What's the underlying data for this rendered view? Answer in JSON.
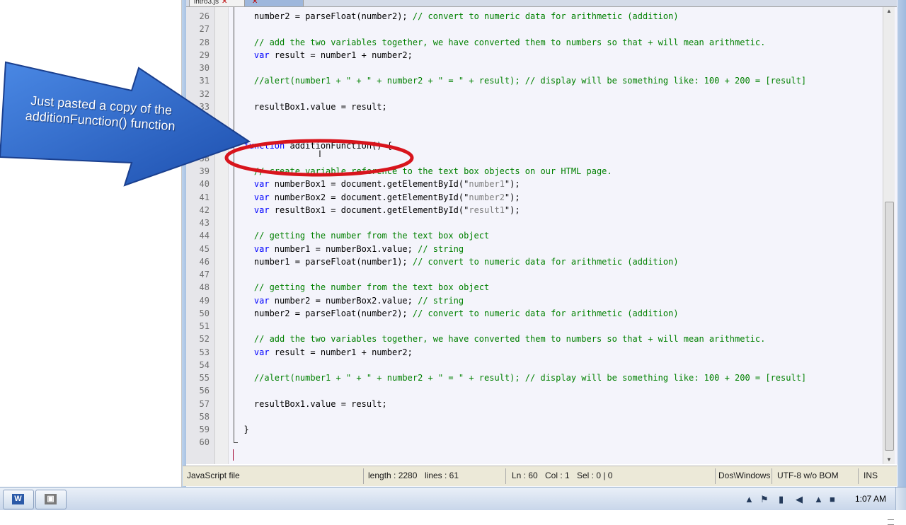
{
  "editor": {
    "tabs": [
      {
        "label": "intro3.js",
        "active": false
      },
      {
        "label": "",
        "active": true
      }
    ],
    "lines": [
      {
        "n": "26",
        "segments": [
          {
            "t": "    number2 = parseFloat(number2); ",
            "c": ""
          },
          {
            "t": "// convert to numeric data for arithmetic (addition)",
            "c": "cmt"
          }
        ]
      },
      {
        "n": "27",
        "segments": []
      },
      {
        "n": "28",
        "segments": [
          {
            "t": "    // add the two variables together, we have converted them to numbers so that + will mean arithmetic.",
            "c": "cmt"
          }
        ]
      },
      {
        "n": "29",
        "segments": [
          {
            "t": "    var",
            "c": "kw"
          },
          {
            "t": " result = number1 + number2;",
            "c": ""
          }
        ]
      },
      {
        "n": "30",
        "segments": []
      },
      {
        "n": "31",
        "segments": [
          {
            "t": "    //alert(number1 + \" + \" + number2 + \" = \" + result); // display will be something like: 100 + 200 = [result]",
            "c": "cmt"
          }
        ]
      },
      {
        "n": "32",
        "segments": []
      },
      {
        "n": "33",
        "segments": [
          {
            "t": "    resultBox1.value = result;",
            "c": ""
          }
        ]
      },
      {
        "n": "",
        "segments": []
      },
      {
        "n": "",
        "segments": []
      },
      {
        "n": "37",
        "segments": [
          {
            "t": "  function",
            "c": "kw"
          },
          {
            "t": " additionFunction() {",
            "c": ""
          }
        ]
      },
      {
        "n": "38",
        "segments": []
      },
      {
        "n": "39",
        "segments": [
          {
            "t": "    // create variable reference to the text box objects on our HTML page.",
            "c": "cmt"
          }
        ]
      },
      {
        "n": "40",
        "segments": [
          {
            "t": "    var",
            "c": "kw"
          },
          {
            "t": " numberBox1 = document.getElementById(\"",
            "c": ""
          },
          {
            "t": "number1",
            "c": "str"
          },
          {
            "t": "\");",
            "c": ""
          }
        ]
      },
      {
        "n": "41",
        "segments": [
          {
            "t": "    var",
            "c": "kw"
          },
          {
            "t": " numberBox2 = document.getElementById(\"",
            "c": ""
          },
          {
            "t": "number2",
            "c": "str"
          },
          {
            "t": "\");",
            "c": ""
          }
        ]
      },
      {
        "n": "42",
        "segments": [
          {
            "t": "    var",
            "c": "kw"
          },
          {
            "t": " resultBox1 = document.getElementById(\"",
            "c": ""
          },
          {
            "t": "result1",
            "c": "str"
          },
          {
            "t": "\");",
            "c": ""
          }
        ]
      },
      {
        "n": "43",
        "segments": []
      },
      {
        "n": "44",
        "segments": [
          {
            "t": "    // getting the number from the text box object",
            "c": "cmt"
          }
        ]
      },
      {
        "n": "45",
        "segments": [
          {
            "t": "    var",
            "c": "kw"
          },
          {
            "t": " number1 = numberBox1.value; ",
            "c": ""
          },
          {
            "t": "// string",
            "c": "cmt"
          }
        ]
      },
      {
        "n": "46",
        "segments": [
          {
            "t": "    number1 = parseFloat(number1); ",
            "c": ""
          },
          {
            "t": "// convert to numeric data for arithmetic (addition)",
            "c": "cmt"
          }
        ]
      },
      {
        "n": "47",
        "segments": []
      },
      {
        "n": "48",
        "segments": [
          {
            "t": "    // getting the number from the text box object",
            "c": "cmt"
          }
        ]
      },
      {
        "n": "49",
        "segments": [
          {
            "t": "    var",
            "c": "kw"
          },
          {
            "t": " number2 = numberBox2.value; ",
            "c": ""
          },
          {
            "t": "// string",
            "c": "cmt"
          }
        ]
      },
      {
        "n": "50",
        "segments": [
          {
            "t": "    number2 = parseFloat(number2); ",
            "c": ""
          },
          {
            "t": "// convert to numeric data for arithmetic (addition)",
            "c": "cmt"
          }
        ]
      },
      {
        "n": "51",
        "segments": []
      },
      {
        "n": "52",
        "segments": [
          {
            "t": "    // add the two variables together, we have converted them to numbers so that + will mean arithmetic.",
            "c": "cmt"
          }
        ]
      },
      {
        "n": "53",
        "segments": [
          {
            "t": "    var",
            "c": "kw"
          },
          {
            "t": " result = number1 + number2;",
            "c": ""
          }
        ]
      },
      {
        "n": "54",
        "segments": []
      },
      {
        "n": "55",
        "segments": [
          {
            "t": "    //alert(number1 + \" + \" + number2 + \" = \" + result); // display will be something like: 100 + 200 = [result]",
            "c": "cmt"
          }
        ]
      },
      {
        "n": "56",
        "segments": []
      },
      {
        "n": "57",
        "segments": [
          {
            "t": "    resultBox1.value = result;",
            "c": ""
          }
        ]
      },
      {
        "n": "58",
        "segments": []
      },
      {
        "n": "59",
        "segments": [
          {
            "t": "  }",
            "c": ""
          }
        ]
      },
      {
        "n": "60",
        "segments": []
      }
    ]
  },
  "callout": {
    "text": "Just pasted a copy of the additionFunction() function"
  },
  "status": {
    "file_type": "JavaScript file",
    "length": "length : 2280",
    "lines": "lines : 61",
    "ln": "Ln : 60",
    "col": "Col : 1",
    "sel": "Sel : 0 | 0",
    "eol": "Dos\\Windows",
    "encoding": "UTF-8 w/o BOM",
    "mode": "INS"
  },
  "taskbar": {
    "clock": "1:07 AM"
  },
  "colors": {
    "comment": "#008000",
    "keyword": "#0000ff",
    "string": "#808080",
    "callout_arrow": "#2a64c8",
    "highlight_ellipse": "#d8141c"
  }
}
